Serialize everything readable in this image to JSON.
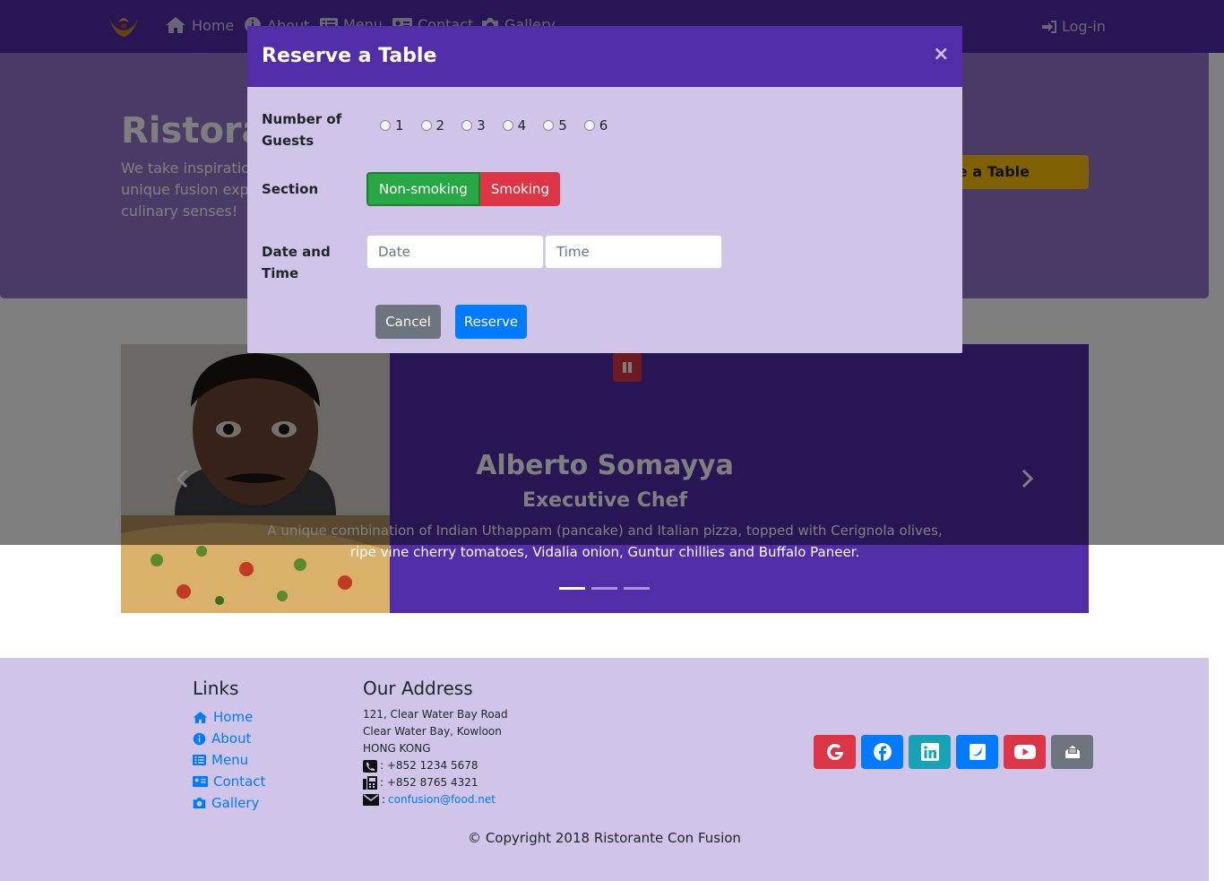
{
  "navbar": {
    "items": [
      {
        "label": "Home",
        "icon": "home-icon"
      },
      {
        "label": "About",
        "icon": "info-icon"
      },
      {
        "label": "Menu",
        "icon": "list-icon"
      },
      {
        "label": "Contact",
        "icon": "address-card-icon"
      },
      {
        "label": "Gallery",
        "icon": "camera-icon"
      }
    ],
    "login_label": "Log-in"
  },
  "jumbotron": {
    "title": "Ristorante Con Fusion",
    "text": "We take inspiration from the World's best cuisines, and create a unique fusion experience. Our lipsmacking creations will tickle your culinary senses!",
    "reserve_label": "Reserve a Table"
  },
  "carousel": {
    "name": "Alberto Somayya",
    "role": "Executive Chef",
    "description": "A unique combination of Indian Uthappam (pancake) and Italian pizza, topped with Cerignola olives, ripe vine cherry tomatoes, Vidalia onion, Guntur chillies and Buffalo Paneer.",
    "pause_color": "#dc3545"
  },
  "modal": {
    "title": "Reserve a Table",
    "close": "×",
    "guests_label": "Number of Guests",
    "guest_options": [
      "1",
      "2",
      "3",
      "4",
      "5",
      "6"
    ],
    "section_label": "Section",
    "section_options": [
      "Non-smoking",
      "Smoking"
    ],
    "datetime_label": "Date and Time",
    "date_placeholder": "Date",
    "time_placeholder": "Time",
    "cancel_label": "Cancel",
    "reserve_label": "Reserve"
  },
  "footer": {
    "links_heading": "Links",
    "links": [
      "Home",
      "About",
      "Menu",
      "Contact",
      "Gallery"
    ],
    "address_heading": "Our Address",
    "address_lines": [
      "121, Clear Water Bay Road",
      "Clear Water Bay, Kowloon",
      "HONG KONG"
    ],
    "phone": ": +852 1234 5678",
    "fax": ": +852 8765 4321",
    "email_prefix": ": ",
    "email": "confusion@food.net",
    "socials": [
      {
        "icon": "google-icon",
        "color": "#dc3545"
      },
      {
        "icon": "facebook-icon",
        "color": "#007bff"
      },
      {
        "icon": "linkedin-icon",
        "color": "#17a2b8"
      },
      {
        "icon": "twitter-icon",
        "color": "#007bff"
      },
      {
        "icon": "youtube-icon",
        "color": "#dc3545"
      },
      {
        "icon": "envelope-icon",
        "color": "#6c757d"
      }
    ],
    "copyright": "© Copyright 2018 Ristorante Con Fusion"
  },
  "colors": {
    "primary": "#512da8",
    "light": "#d1c4e9",
    "jumbotron": "#9575cd",
    "warning": "#ffc107"
  }
}
